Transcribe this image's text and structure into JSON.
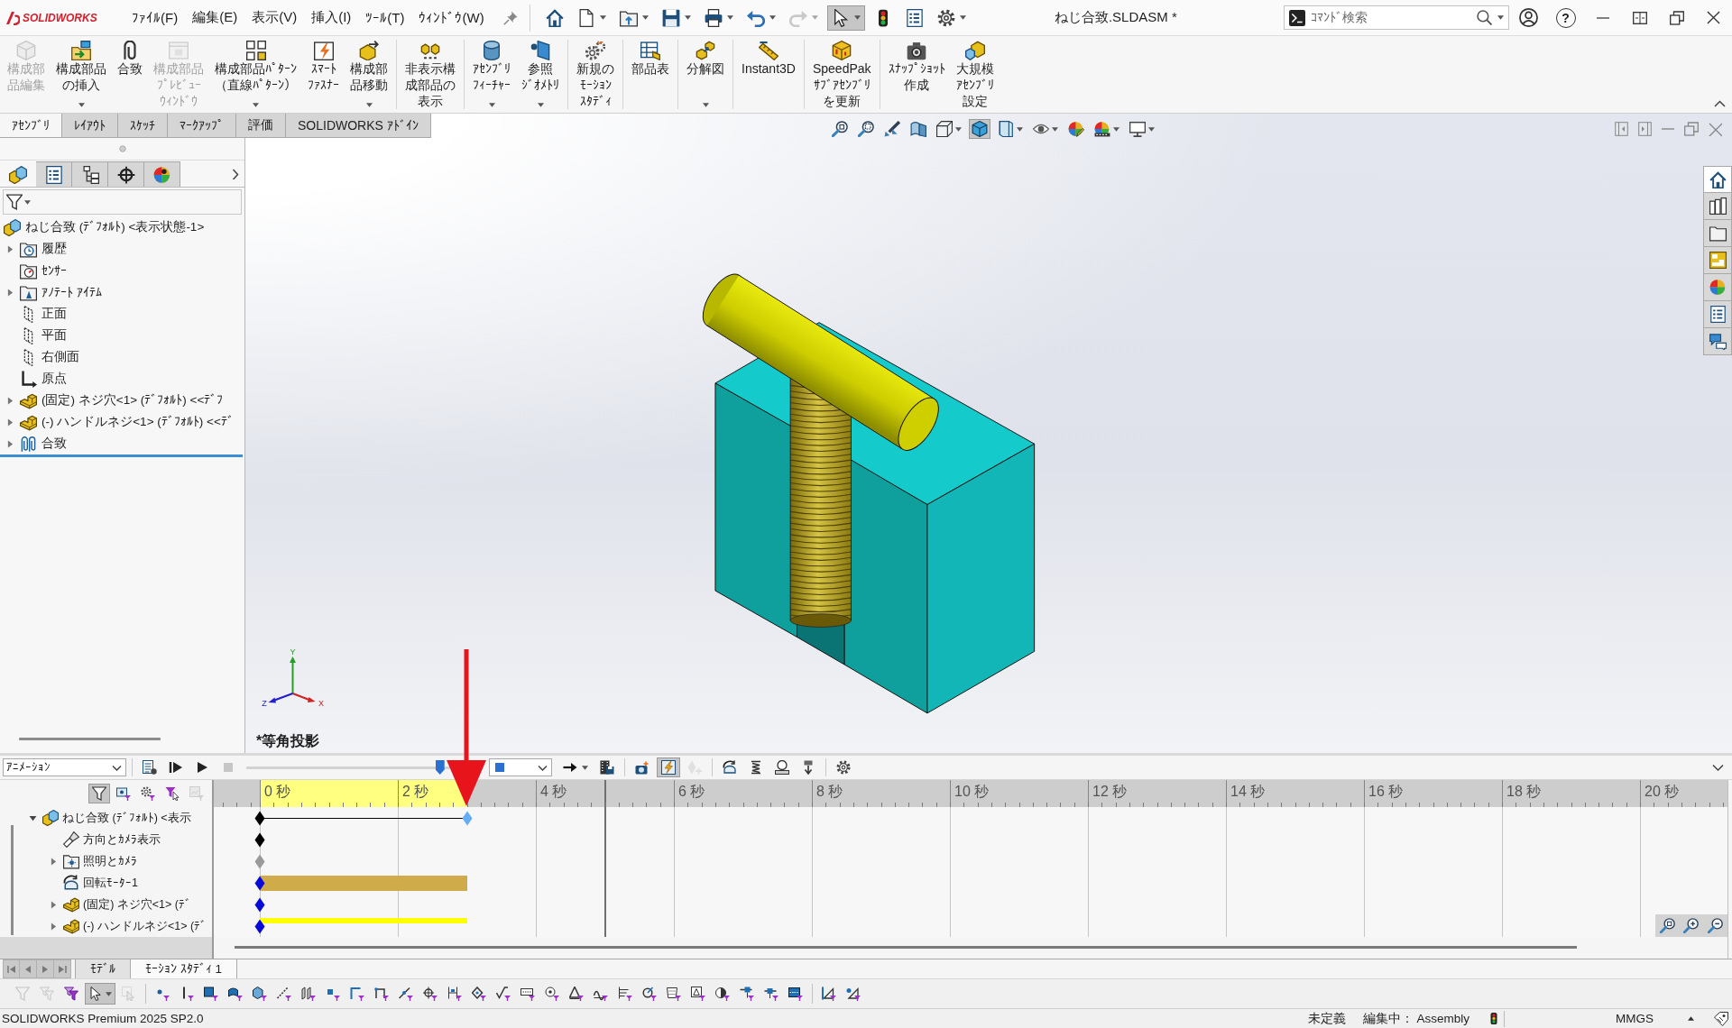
{
  "title_bar": {
    "logo": "SOLIDWORKS",
    "menus": [
      "ﾌｧｲﾙ(F)",
      "編集(E)",
      "表示(V)",
      "挿入(I)",
      "ﾂｰﾙ(T)",
      "ｳｨﾝﾄﾞｳ(W)"
    ],
    "quick_access": [
      {
        "kind": "home",
        "dropdown": false,
        "disabled": false,
        "pressed": false
      },
      {
        "kind": "new",
        "dropdown": true,
        "disabled": false,
        "pressed": false
      },
      {
        "kind": "open",
        "dropdown": true,
        "disabled": false,
        "pressed": false
      },
      {
        "kind": "save",
        "dropdown": true,
        "disabled": false,
        "pressed": false
      },
      {
        "kind": "print",
        "dropdown": true,
        "disabled": false,
        "pressed": false
      },
      {
        "kind": "undo",
        "dropdown": true,
        "disabled": false,
        "pressed": false
      },
      {
        "kind": "redo",
        "dropdown": true,
        "disabled": true,
        "pressed": false
      },
      {
        "kind": "select",
        "dropdown": true,
        "disabled": false,
        "pressed": true
      },
      {
        "kind": "rebuild",
        "dropdown": false,
        "disabled": false,
        "pressed": false
      },
      {
        "kind": "file-properties",
        "dropdown": false,
        "disabled": false,
        "pressed": false
      },
      {
        "kind": "options",
        "dropdown": true,
        "disabled": false,
        "pressed": false
      }
    ],
    "document_title": "ねじ合致.SLDASM *",
    "search": {
      "placeholder": "ｺﾏﾝﾄﾞ検索"
    },
    "help": "?"
  },
  "ribbon": {
    "groups": [
      [
        {
          "label": "構成部品編集",
          "kind": "edit-component",
          "disabled": true,
          "dropdown": false
        },
        {
          "label": "構成部品の挿入",
          "kind": "insert-component",
          "disabled": false,
          "dropdown": true
        },
        {
          "label": "合致",
          "kind": "mate",
          "disabled": false,
          "dropdown": false
        },
        {
          "label": "構成部品ﾌﾟﾚﾋﾞｭｰｳｨﾝﾄﾞｳ",
          "kind": "preview-window",
          "disabled": true,
          "dropdown": false
        },
        {
          "label": "構成部品ﾊﾟﾀｰﾝ（直線ﾊﾟﾀｰﾝ）",
          "kind": "pattern",
          "disabled": false,
          "dropdown": true
        },
        {
          "label": "ｽﾏｰﾄﾌｧｽﾅｰ",
          "kind": "smart-fastener",
          "disabled": false,
          "dropdown": false
        },
        {
          "label": "構成部品移動",
          "kind": "move-component",
          "disabled": false,
          "dropdown": true
        }
      ],
      [
        {
          "label": "非表示構成部品の表示",
          "kind": "show-hidden",
          "disabled": false,
          "dropdown": false
        }
      ],
      [
        {
          "label": "ｱｾﾝﾌﾞﾘﾌｨｰﾁｬｰ",
          "kind": "assembly-feature",
          "disabled": false,
          "dropdown": true
        },
        {
          "label": "参照ｼﾞｵﾒﾄﾘ",
          "kind": "reference-geometry",
          "disabled": false,
          "dropdown": true
        }
      ],
      [
        {
          "label": "新規のﾓｰｼｮﾝｽﾀﾃﾞｨ",
          "kind": "motion-study",
          "disabled": false,
          "dropdown": false
        }
      ],
      [
        {
          "label": "部品表",
          "kind": "bom",
          "disabled": false,
          "dropdown": false
        }
      ],
      [
        {
          "label": "分解図",
          "kind": "exploded-view",
          "disabled": false,
          "dropdown": true
        }
      ],
      [
        {
          "label": "Instant3D",
          "kind": "instant3d",
          "disabled": false,
          "dropdown": false
        }
      ],
      [
        {
          "label": "SpeedPakｻﾌﾞｱｾﾝﾌﾞﾘを更新",
          "kind": "speedpak",
          "disabled": false,
          "dropdown": false
        }
      ],
      [
        {
          "label": "ｽﾅｯﾌﾟｼｮｯﾄ作成",
          "kind": "snapshot",
          "disabled": false,
          "dropdown": false
        },
        {
          "label": "大規模ｱｾﾝﾌﾞﾘ設定",
          "kind": "large-assembly",
          "disabled": false,
          "dropdown": false
        }
      ]
    ]
  },
  "ribbon_tabs": [
    {
      "label": "ｱｾﾝﾌﾞﾘ",
      "selected": true
    },
    {
      "label": "ﾚｲｱｳﾄ",
      "selected": false
    },
    {
      "label": "ｽｹｯﾁ",
      "selected": false
    },
    {
      "label": "ﾏｰｸｱｯﾌﾟ",
      "selected": false
    },
    {
      "label": "評価",
      "selected": false
    },
    {
      "label": "SOLIDWORKS ｱﾄﾞｲﾝ",
      "selected": false
    }
  ],
  "feature_manager": {
    "tabs": [
      {
        "kind": "feature-tree",
        "selected": true
      },
      {
        "kind": "property",
        "selected": false
      },
      {
        "kind": "configuration",
        "selected": false
      },
      {
        "kind": "dimxpert",
        "selected": false
      },
      {
        "kind": "display",
        "selected": false
      }
    ],
    "tree": [
      {
        "label": "ねじ合致 (ﾃﾞﾌｫﾙﾄ) <表示状態-1>",
        "kind": "assembly",
        "expandable": false,
        "children": [
          {
            "label": "履歴",
            "kind": "history",
            "expandable": true,
            "expanded": false
          },
          {
            "label": "ｾﾝｻｰ",
            "kind": "sensor",
            "expandable": false
          },
          {
            "label": "ｱﾉﾃｰﾄ ｱｲﾃﾑ",
            "kind": "annotation",
            "expandable": true,
            "expanded": false
          },
          {
            "label": "正面",
            "kind": "plane",
            "expandable": false
          },
          {
            "label": "平面",
            "kind": "plane",
            "expandable": false
          },
          {
            "label": "右側面",
            "kind": "plane",
            "expandable": false
          },
          {
            "label": "原点",
            "kind": "origin",
            "expandable": false
          },
          {
            "label": "(固定) ネジ穴<1> (ﾃﾞﾌｫﾙﾄ) <<ﾃﾞﾌ",
            "kind": "part",
            "expandable": true,
            "expanded": false
          },
          {
            "label": "(-) ハンドルネジ<1> (ﾃﾞﾌｫﾙﾄ) <<ﾃﾞ",
            "kind": "part",
            "expandable": true,
            "expanded": false
          },
          {
            "label": "合致",
            "kind": "mates",
            "expandable": true,
            "expanded": false
          }
        ]
      }
    ]
  },
  "graphics": {
    "heads_up": [
      {
        "kind": "zoom-to-fit",
        "dropdown": false,
        "pressed": false
      },
      {
        "kind": "zoom-to-area",
        "dropdown": false,
        "pressed": false
      },
      {
        "kind": "previous-view",
        "dropdown": false,
        "pressed": false
      },
      {
        "kind": "section-view",
        "dropdown": false,
        "pressed": false
      },
      {
        "kind": "view-orientation",
        "dropdown": true,
        "pressed": false
      },
      {
        "kind": "shaded",
        "dropdown": false,
        "pressed": true
      },
      {
        "kind": "display-style",
        "dropdown": true,
        "pressed": false
      },
      {
        "kind": "hide-show-items",
        "dropdown": true,
        "pressed": false
      },
      {
        "kind": "edit-appearance",
        "dropdown": false,
        "pressed": false
      },
      {
        "kind": "apply-scene",
        "dropdown": true,
        "pressed": false
      },
      {
        "kind": "view-settings",
        "dropdown": true,
        "pressed": false
      }
    ],
    "task_pane": [
      {
        "kind": "home",
        "selected": true
      },
      {
        "kind": "design-library",
        "selected": false
      },
      {
        "kind": "file-explorer",
        "selected": false
      },
      {
        "kind": "view-palette",
        "selected": false
      },
      {
        "kind": "appearances",
        "selected": false
      },
      {
        "kind": "custom-properties",
        "selected": false
      },
      {
        "kind": "forum",
        "selected": false
      }
    ],
    "view_name": "*等角投影",
    "axes": [
      {
        "label": "Y"
      },
      {
        "label": "Z"
      },
      {
        "label": "X"
      }
    ]
  },
  "motion": {
    "toolbar": {
      "study_type": "ｱﾆﾒｰｼｮﾝ",
      "playback": [
        {
          "kind": "calculate",
          "disabled": false,
          "pressed": false
        },
        {
          "kind": "play-from-start",
          "disabled": false,
          "pressed": false
        },
        {
          "kind": "play",
          "disabled": false,
          "pressed": false
        },
        {
          "kind": "stop",
          "disabled": true,
          "pressed": false
        }
      ],
      "slider": {
        "level": 0.95
      },
      "tools": [
        [
          {
            "kind": "playback-mode",
            "dropdown": true,
            "disabled": false,
            "pressed": false
          },
          {
            "kind": "save-animation",
            "dropdown": false,
            "disabled": false,
            "pressed": false
          }
        ],
        [
          {
            "kind": "animation-wizard",
            "dropdown": false,
            "disabled": false,
            "pressed": false
          },
          {
            "kind": "autokey",
            "dropdown": false,
            "disabled": false,
            "pressed": true
          },
          {
            "kind": "add-key",
            "dropdown": false,
            "disabled": true,
            "pressed": false
          }
        ],
        [
          {
            "kind": "motor",
            "dropdown": false,
            "disabled": false,
            "pressed": false
          },
          {
            "kind": "spring",
            "dropdown": false,
            "disabled": false,
            "pressed": false
          },
          {
            "kind": "contact",
            "dropdown": false,
            "disabled": false,
            "pressed": false
          },
          {
            "kind": "gravity",
            "dropdown": false,
            "disabled": false,
            "pressed": false
          }
        ],
        [
          {
            "kind": "study-properties",
            "dropdown": false,
            "disabled": false,
            "pressed": false
          }
        ]
      ]
    },
    "filters": [
      {
        "kind": "filter",
        "disabled": false,
        "pressed": true
      },
      {
        "kind": "folder-funnel",
        "disabled": false,
        "pressed": false
      },
      {
        "kind": "gear-funnel",
        "disabled": false,
        "pressed": false
      },
      {
        "kind": "cursor-funnel",
        "disabled": false,
        "pressed": false
      },
      {
        "kind": "chart-funnel",
        "disabled": true,
        "pressed": false
      }
    ],
    "ruler": {
      "labels": [
        "0 秒",
        "2 秒",
        "4 秒",
        "6 秒",
        "8 秒",
        "10 秒",
        "12 秒",
        "14 秒",
        "16 秒",
        "18 秒",
        "20 秒"
      ],
      "highlight": {
        "level": 0.15
      }
    },
    "time_bar": {
      "level": 0.25
    },
    "tree": [
      {
        "label": "ねじ合致 (ﾃﾞﾌｫﾙﾄ) <表示",
        "kind": "assembly",
        "expandable": true,
        "expanded": true,
        "keys": [
          {
            "color": "#000000",
            "level": 0
          },
          {
            "color": "#62aef5",
            "level": 0.15
          }
        ],
        "bar": {
          "kind": "line",
          "level": 0.15
        },
        "children": [
          {
            "label": "方向とｶﾒﾗ表示",
            "kind": "camera-view",
            "expandable": false,
            "keys": [
              {
                "color": "#000000",
                "level": 0
              }
            ]
          },
          {
            "label": "照明とｶﾒﾗ",
            "kind": "lights",
            "expandable": true,
            "expanded": false,
            "keys": [
              {
                "color": "#9a9a9a",
                "level": 0
              }
            ]
          },
          {
            "label": "回転ﾓｰﾀｰ1",
            "kind": "motor",
            "expandable": false,
            "keys": [
              {
                "color": "#0a0ad8",
                "level": 0
              }
            ],
            "bar": {
              "kind": "motor",
              "level": 0.15
            }
          },
          {
            "label": "(固定) ネジ穴<1> (ﾃﾞ",
            "kind": "part",
            "expandable": true,
            "expanded": false,
            "keys": [
              {
                "color": "#0a0ad8",
                "level": 0
              }
            ]
          },
          {
            "label": "(-) ハンドルネジ<1> (ﾃﾞ",
            "kind": "part",
            "expandable": true,
            "expanded": false,
            "keys": [
              {
                "color": "#0a0ad8",
                "level": 0
              }
            ],
            "bar": {
              "kind": "motion",
              "level": 0.15
            }
          }
        ]
      }
    ]
  },
  "study_tabs": [
    {
      "label": "ﾓﾃﾞﾙ",
      "selected": false
    },
    {
      "label": "ﾓｰｼｮﾝ ｽﾀﾃﾞｨ 1",
      "selected": true
    }
  ],
  "selection_toolbar": {
    "groups": [
      [
        {
          "kind": "funnel",
          "dropdown": false,
          "disabled": true,
          "pressed": false
        },
        {
          "kind": "funnel-stack",
          "dropdown": false,
          "disabled": true,
          "pressed": false
        },
        {
          "kind": "funnel-stack-purple",
          "dropdown": false,
          "disabled": false,
          "pressed": false
        },
        {
          "kind": "select",
          "dropdown": true,
          "disabled": false,
          "pressed": true
        },
        {
          "kind": "select-box",
          "dropdown": false,
          "disabled": true,
          "pressed": false
        }
      ],
      [
        {
          "kind": "dot",
          "disabled": false,
          "pressed": false
        },
        {
          "kind": "vertical-line",
          "disabled": false,
          "pressed": false
        },
        {
          "kind": "square",
          "disabled": false,
          "pressed": false
        },
        {
          "kind": "curved-face",
          "disabled": false,
          "pressed": false
        },
        {
          "kind": "cube",
          "disabled": false,
          "pressed": false
        },
        {
          "kind": "dashed-line",
          "disabled": false,
          "pressed": false
        },
        {
          "kind": "planes",
          "disabled": false,
          "pressed": false
        },
        {
          "kind": "small-square",
          "disabled": false,
          "pressed": false
        },
        {
          "kind": "corner",
          "disabled": false,
          "pressed": false
        },
        {
          "kind": "bracket",
          "disabled": false,
          "pressed": false
        },
        {
          "kind": "diagonal",
          "disabled": false,
          "pressed": false
        },
        {
          "kind": "target",
          "disabled": false,
          "pressed": false
        },
        {
          "kind": "dimension",
          "disabled": false,
          "pressed": false
        },
        {
          "kind": "diamond",
          "disabled": false,
          "pressed": false
        },
        {
          "kind": "check",
          "disabled": false,
          "pressed": false
        },
        {
          "kind": "text-box",
          "disabled": false,
          "pressed": false
        },
        {
          "kind": "circle-dot",
          "disabled": false,
          "pressed": false
        },
        {
          "kind": "triangle",
          "disabled": false,
          "pressed": false
        },
        {
          "kind": "wave",
          "disabled": false,
          "pressed": false
        },
        {
          "kind": "lines",
          "disabled": false,
          "pressed": false
        },
        {
          "kind": "circle-arrow",
          "disabled": false,
          "pressed": false
        },
        {
          "kind": "cup",
          "disabled": false,
          "pressed": false
        },
        {
          "kind": "boxed-triangle",
          "disabled": false,
          "pressed": false
        },
        {
          "kind": "half-disc",
          "disabled": false,
          "pressed": false
        },
        {
          "kind": "line-square",
          "disabled": false,
          "pressed": false
        },
        {
          "kind": "line-square-alt",
          "disabled": false,
          "pressed": false
        },
        {
          "kind": "box-dash",
          "disabled": false,
          "pressed": false
        }
      ],
      [
        {
          "kind": "triangle-line",
          "disabled": false,
          "pressed": false
        },
        {
          "kind": "triangle-dot",
          "disabled": false,
          "pressed": false
        }
      ]
    ]
  },
  "status_bar": {
    "product": "SOLIDWORKS Premium 2025 SP2.0",
    "state": "未定義",
    "editing": "編集中： Assembly",
    "units": "MMGS"
  },
  "annotations": [
    {
      "kind": "arrow"
    }
  ]
}
